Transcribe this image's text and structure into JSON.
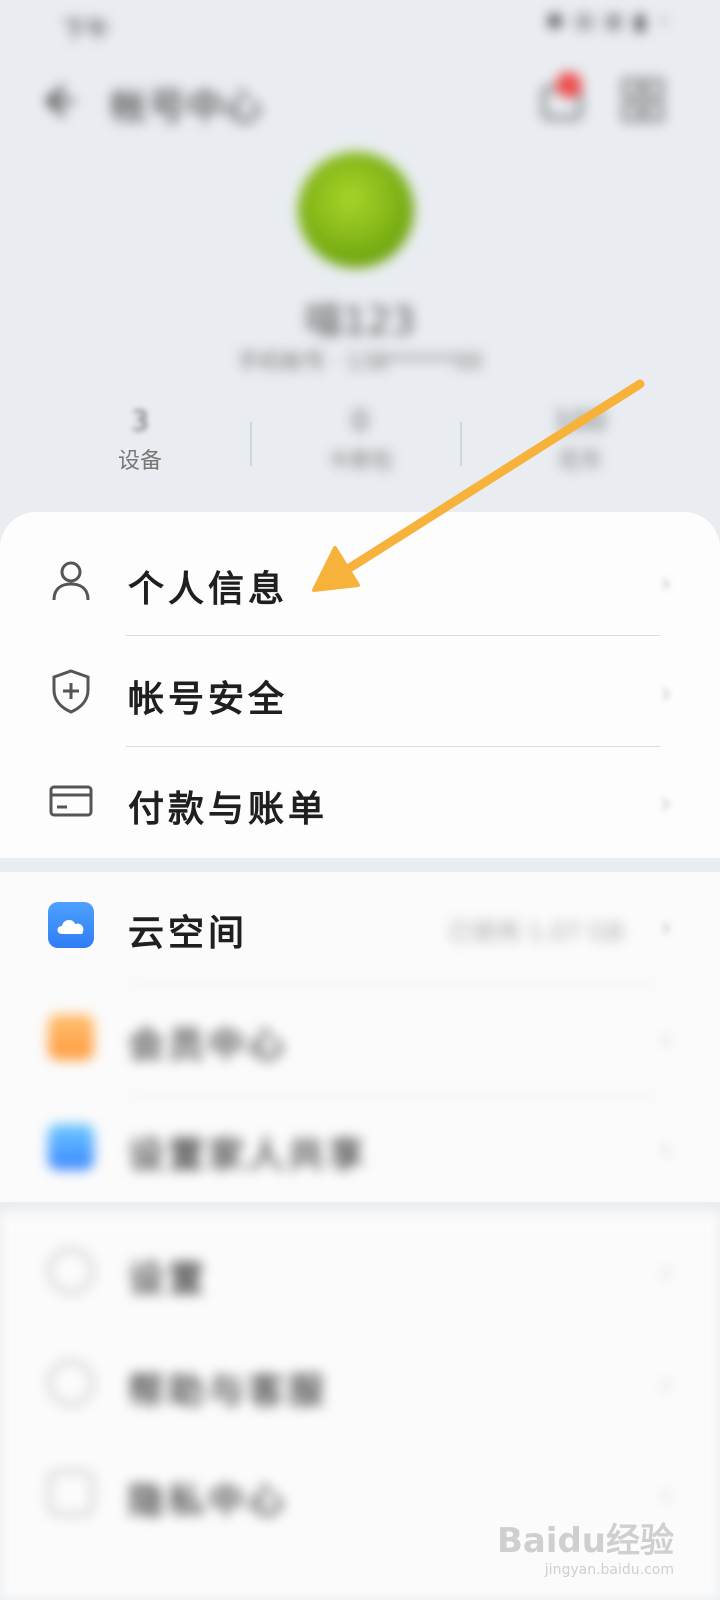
{
  "status_bar": {
    "time": "下午",
    "system": "✱ ⊟ ⊞ ▮ ◦"
  },
  "header": {
    "title": "帐号中心"
  },
  "profile": {
    "username": "喵123",
    "subinfo": "手机帐号 · 138******00"
  },
  "stats": [
    {
      "value": "3",
      "label": "设备"
    },
    {
      "value": "0",
      "label": "卡券包"
    },
    {
      "value": "100",
      "label": "花币"
    }
  ],
  "section1": [
    {
      "label": "个人信息",
      "icon": "person-icon"
    },
    {
      "label": "帐号安全",
      "icon": "shield-icon"
    },
    {
      "label": "付款与账单",
      "icon": "card-icon"
    }
  ],
  "section2": [
    {
      "label": "云空间",
      "icon": "cloud-icon",
      "right_text": "已使用 1.07 GB"
    },
    {
      "label": "会员中心",
      "icon": "vip-icon"
    },
    {
      "label": "设置家人共享",
      "icon": "family-icon"
    }
  ],
  "section3": [
    {
      "label": "设置",
      "icon": "settings-icon"
    },
    {
      "label": "帮助与客服",
      "icon": "help-icon"
    },
    {
      "label": "隐私中心",
      "icon": "privacy-icon"
    }
  ],
  "chevron": "›",
  "watermark": {
    "logo": "Baidu经验",
    "url": "jingyan.baidu.com"
  },
  "colors": {
    "arrow": "#f7b23b",
    "badge": "#ef4b4b",
    "cloud": "#2f7df5",
    "vip": "#ff9c3c"
  }
}
